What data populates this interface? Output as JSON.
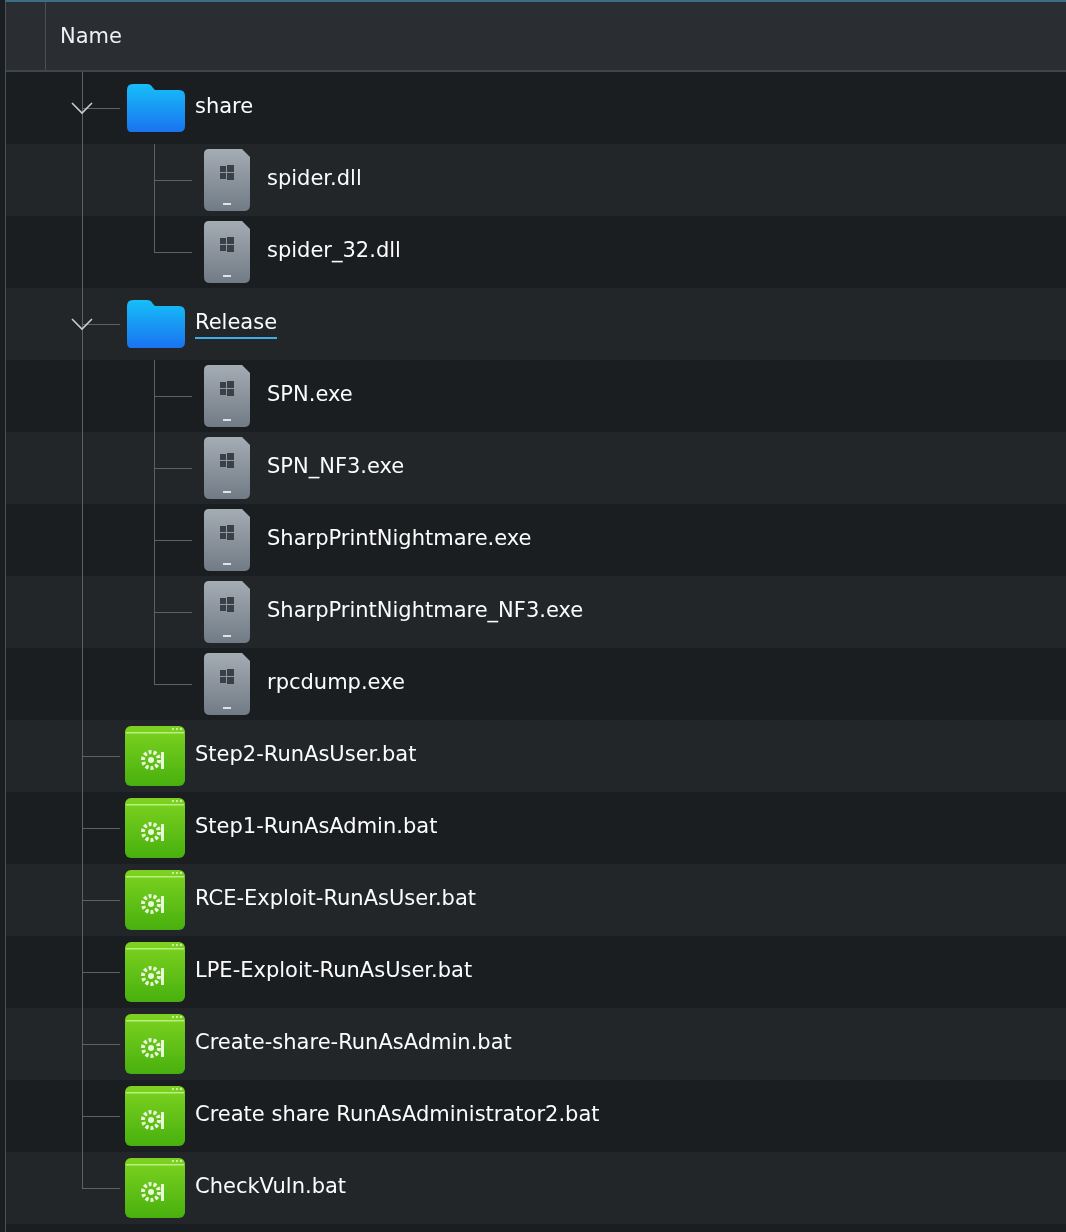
{
  "header": {
    "columns": [
      {
        "label": "Name"
      }
    ]
  },
  "tree": [
    {
      "name": "share",
      "kind": "folder",
      "expanded": true,
      "hovered": false,
      "children": [
        {
          "name": "spider.dll",
          "kind": "binary",
          "hovered": false
        },
        {
          "name": "spider_32.dll",
          "kind": "binary",
          "hovered": false
        }
      ]
    },
    {
      "name": "Release",
      "kind": "folder",
      "expanded": true,
      "hovered": true,
      "children": [
        {
          "name": "SPN.exe",
          "kind": "binary",
          "hovered": false
        },
        {
          "name": "SPN_NF3.exe",
          "kind": "binary",
          "hovered": false
        },
        {
          "name": "SharpPrintNightmare.exe",
          "kind": "binary",
          "hovered": false
        },
        {
          "name": "SharpPrintNightmare_NF3.exe",
          "kind": "binary",
          "hovered": false
        },
        {
          "name": "rpcdump.exe",
          "kind": "binary",
          "hovered": false
        }
      ]
    },
    {
      "name": "Step2-RunAsUser.bat",
      "kind": "script",
      "hovered": false
    },
    {
      "name": "Step1-RunAsAdmin.bat",
      "kind": "script",
      "hovered": false
    },
    {
      "name": "RCE-Exploit-RunAsUser.bat",
      "kind": "script",
      "hovered": false
    },
    {
      "name": "LPE-Exploit-RunAsUser.bat",
      "kind": "script",
      "hovered": false
    },
    {
      "name": "Create-share-RunAsAdmin.bat",
      "kind": "script",
      "hovered": false
    },
    {
      "name": "Create share RunAsAdministrator2.bat",
      "kind": "script",
      "hovered": false
    },
    {
      "name": "CheckVuln.bat",
      "kind": "script",
      "hovered": false
    }
  ]
}
